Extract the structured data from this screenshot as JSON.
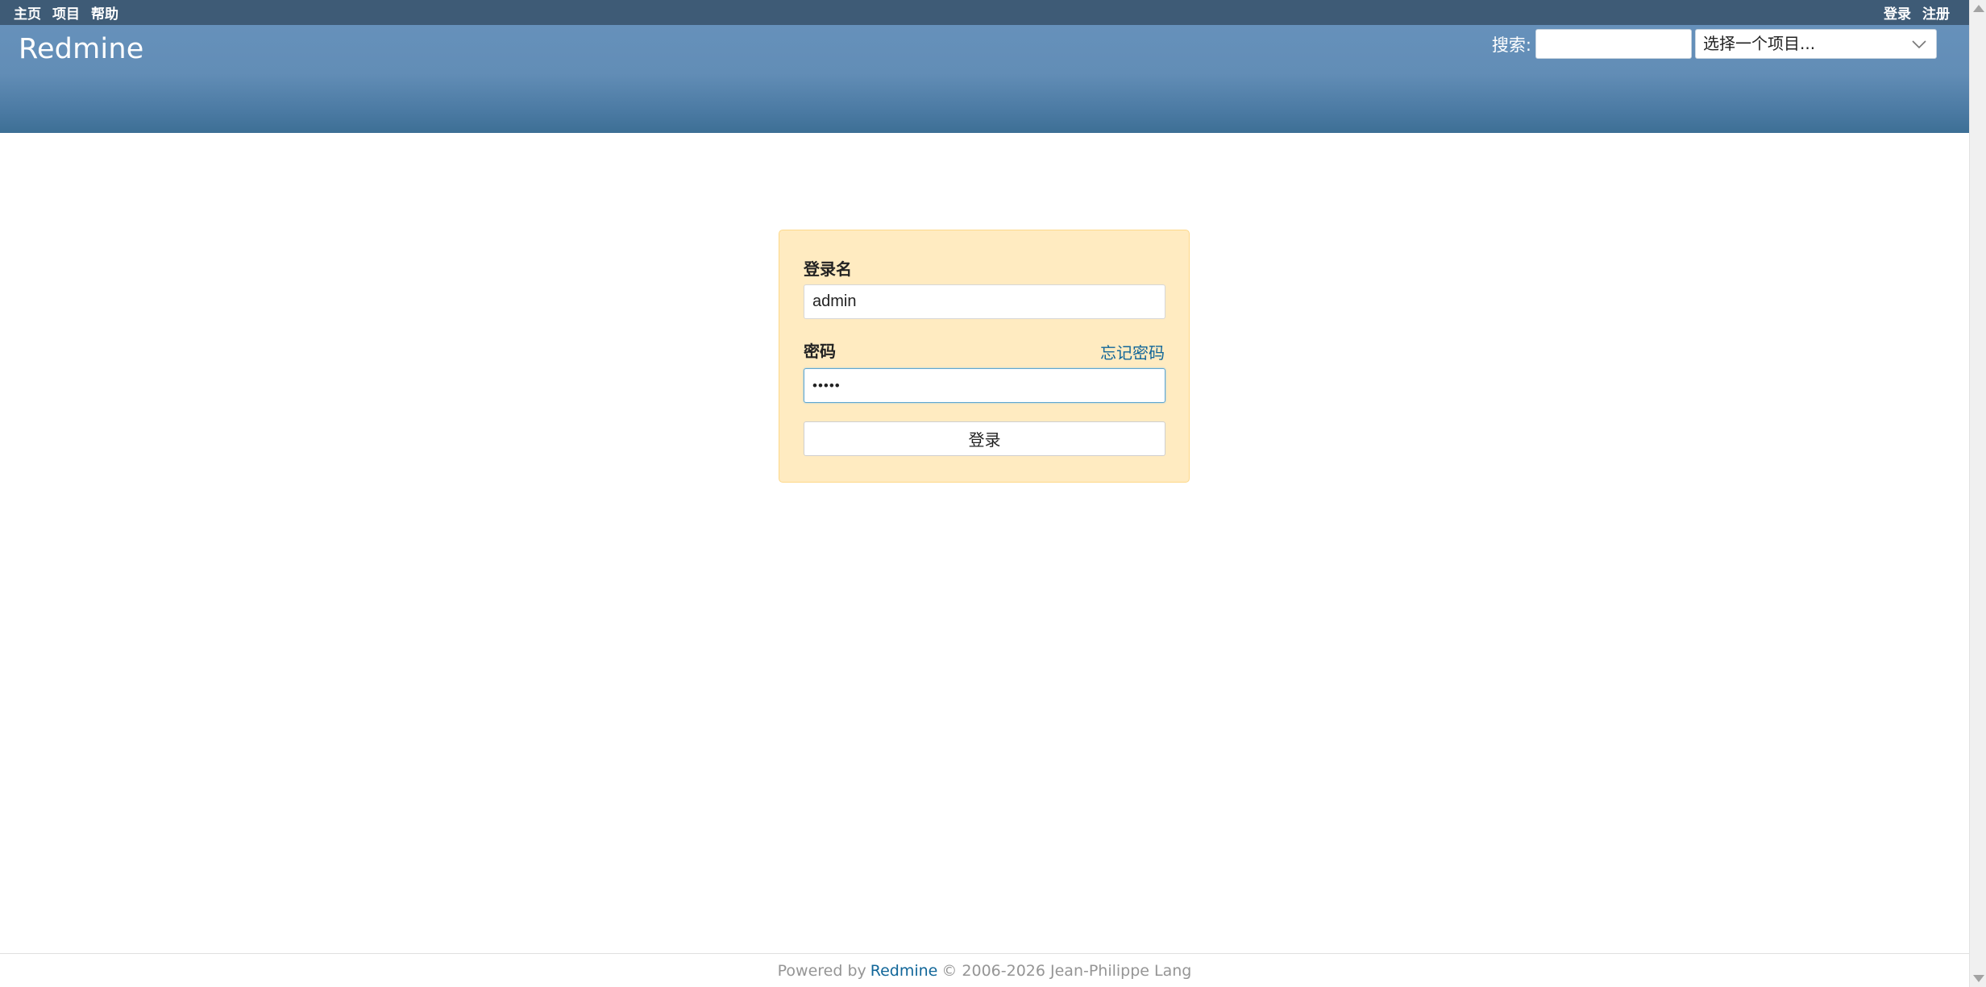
{
  "top_menu": {
    "left_items": [
      "主页",
      "项目",
      "帮助"
    ],
    "right_items": [
      "登录",
      "注册"
    ]
  },
  "header": {
    "site_title": "Redmine",
    "search_label": "搜索:",
    "search_value": "",
    "project_jump_placeholder": "选择一个项目..."
  },
  "login": {
    "username_label": "登录名",
    "username_value": "admin",
    "password_label": "密码",
    "password_value": "•••••",
    "lost_password": "忘记密码",
    "submit_label": "登录"
  },
  "footer": {
    "prefix": "Powered by",
    "link": "Redmine",
    "suffix": "© 2006-2026 Jean-Philippe Lang"
  },
  "icons": {
    "project_jump": "chevron-down-icon",
    "scroll_up": "scroll-up-arrow-icon",
    "scroll_down": "scroll-down-arrow-icon"
  },
  "colors": {
    "top_menu_bg": "#3e5b76",
    "header_top": "#6691bb",
    "header_bottom": "#3d6f95",
    "login_box_bg": "#ffebc1",
    "login_box_border": "#fdd88a",
    "link": "#116699"
  }
}
